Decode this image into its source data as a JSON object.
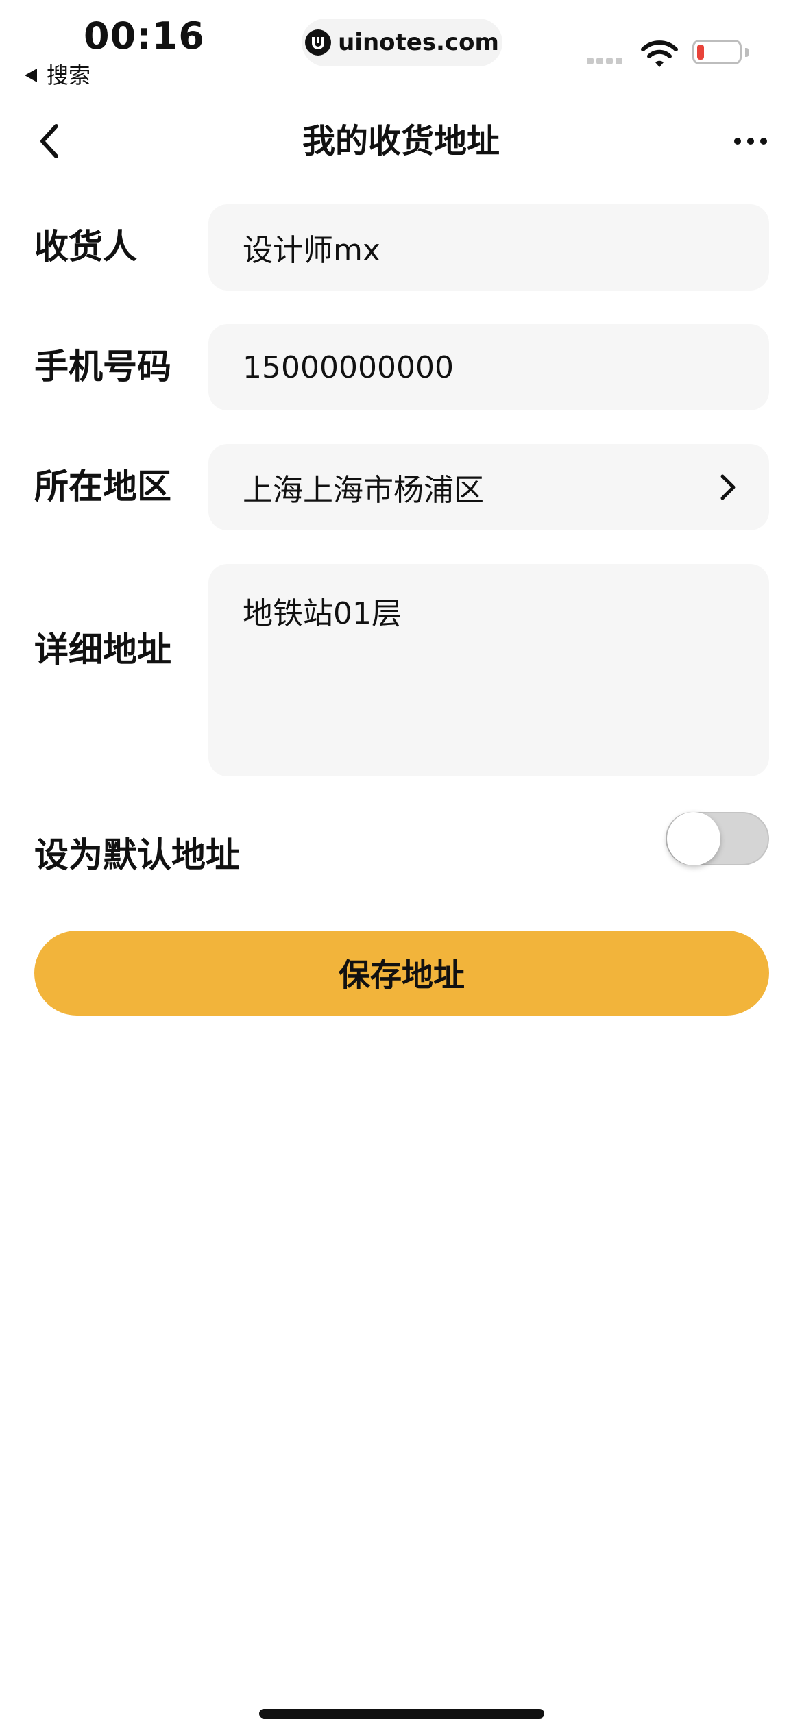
{
  "status_bar": {
    "time": "00:16",
    "back_app_label": "搜索",
    "url": "uinotes.com"
  },
  "nav": {
    "title": "我的收货地址",
    "icons": [
      "chevron-left-icon",
      "more-icon"
    ]
  },
  "form": {
    "recipient": {
      "label": "收货人",
      "value": "设计师mx"
    },
    "phone": {
      "label": "手机号码",
      "value": "15000000000"
    },
    "region": {
      "label": "所在地区",
      "value": "上海上海市杨浦区"
    },
    "address": {
      "label": "详细地址",
      "value": "地铁站01层"
    },
    "default_address": {
      "label": "设为默认地址",
      "enabled": false
    }
  },
  "save_button": {
    "label": "保存地址"
  },
  "colors": {
    "accent": "#f2b43b",
    "field_background": "#f6f6f6",
    "battery_low": "#e8433a"
  }
}
